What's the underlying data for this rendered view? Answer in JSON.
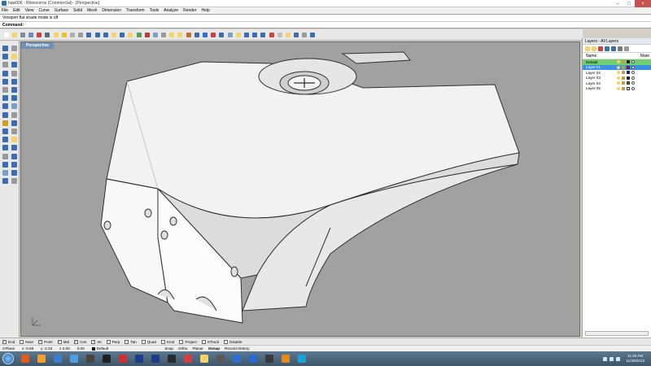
{
  "window": {
    "title": "haw006 - Rhinoceros (Commercial) - [Perspective]"
  },
  "menu": [
    "File",
    "Edit",
    "View",
    "Curve",
    "Surface",
    "Solid",
    "Mesh",
    "Dimension",
    "Transform",
    "Tools",
    "Analyze",
    "Render",
    "Help"
  ],
  "command": {
    "history": "Viewport flat shade mode is off",
    "label": "Command:",
    "value": ""
  },
  "toolbar": {
    "icon_colors": [
      "#ffffff",
      "#f3d36a",
      "#7f8c9a",
      "#6b8fb8",
      "#d04040",
      "#5a6a80",
      "#f3d36a",
      "#f0c030",
      "#b0b0b0",
      "#9a9a9a",
      "#3d6db0",
      "#3d6db0",
      "#3d6db0",
      "#f3d36a",
      "#3d6db0",
      "#f3d36a",
      "#5a9a5a",
      "#b04040",
      "#7aa0c8",
      "#9a9a9a",
      "#f3d36a",
      "#f3d36a",
      "#c07030",
      "#3d6db0",
      "#2f6fd0",
      "#d04040",
      "#3d6db0",
      "#7aa0c8",
      "#f3d36a",
      "#3d6db0",
      "#3d6db0",
      "#3d6db0",
      "#d04040",
      "#c0c0c0",
      "#f3d36a",
      "#3d6db0",
      "#9a9a9a",
      "#3d6db0"
    ]
  },
  "viewport": {
    "name": "Perspective",
    "background": "#a1a1a1"
  },
  "layers_panel": {
    "title": "Layers - All Layers",
    "col_name": "Name",
    "col_material": "Mate",
    "layers": [
      {
        "name": "Default",
        "state": "current",
        "color": "#000000"
      },
      {
        "name": "Layer 01",
        "state": "selected",
        "color": "#ff0000"
      },
      {
        "name": "Layer 02",
        "state": "normal",
        "color": "#0000ff"
      },
      {
        "name": "Layer 03",
        "state": "normal",
        "color": "#0000a0"
      },
      {
        "name": "Layer 04",
        "state": "normal",
        "color": "#00a000"
      },
      {
        "name": "Layer 05",
        "state": "normal",
        "color": "#ffffff"
      }
    ]
  },
  "osnaps": [
    {
      "label": "End",
      "checked": true
    },
    {
      "label": "Near",
      "checked": false
    },
    {
      "label": "Point",
      "checked": true
    },
    {
      "label": "Mid",
      "checked": true
    },
    {
      "label": "Cen",
      "checked": true
    },
    {
      "label": "Int",
      "checked": true
    },
    {
      "label": "Perp",
      "checked": false
    },
    {
      "label": "Tan",
      "checked": false
    },
    {
      "label": "Quad",
      "checked": false
    },
    {
      "label": "Knot",
      "checked": false
    },
    {
      "label": "Project",
      "checked": false
    },
    {
      "label": "STrack",
      "checked": false
    },
    {
      "label": "Disable",
      "checked": false
    }
  ],
  "status": {
    "cplane": "CPlane",
    "x": "x -0.58",
    "y": "y -2.33",
    "z": "z 0.00",
    "dist": "0.00",
    "layer": "Default",
    "toggles": [
      "Snap",
      "Ortho",
      "Planar",
      "Osnap",
      "Record History"
    ]
  },
  "taskbar": {
    "app_colors": [
      "#e25b1a",
      "#f0a030",
      "#3a7fd0",
      "#4d9fe0",
      "#444444",
      "#202020",
      "#cc3030",
      "#1e3a8a",
      "#1e3a8a",
      "#2a2a2a",
      "#d04040",
      "#f3d36a",
      "#5a5a5a",
      "#2f6fd0",
      "#2a6ad0",
      "#3a3a3a",
      "#e08a20",
      "#1e9fd8"
    ],
    "time": "11:46 AM",
    "date": "11/28/2013"
  }
}
